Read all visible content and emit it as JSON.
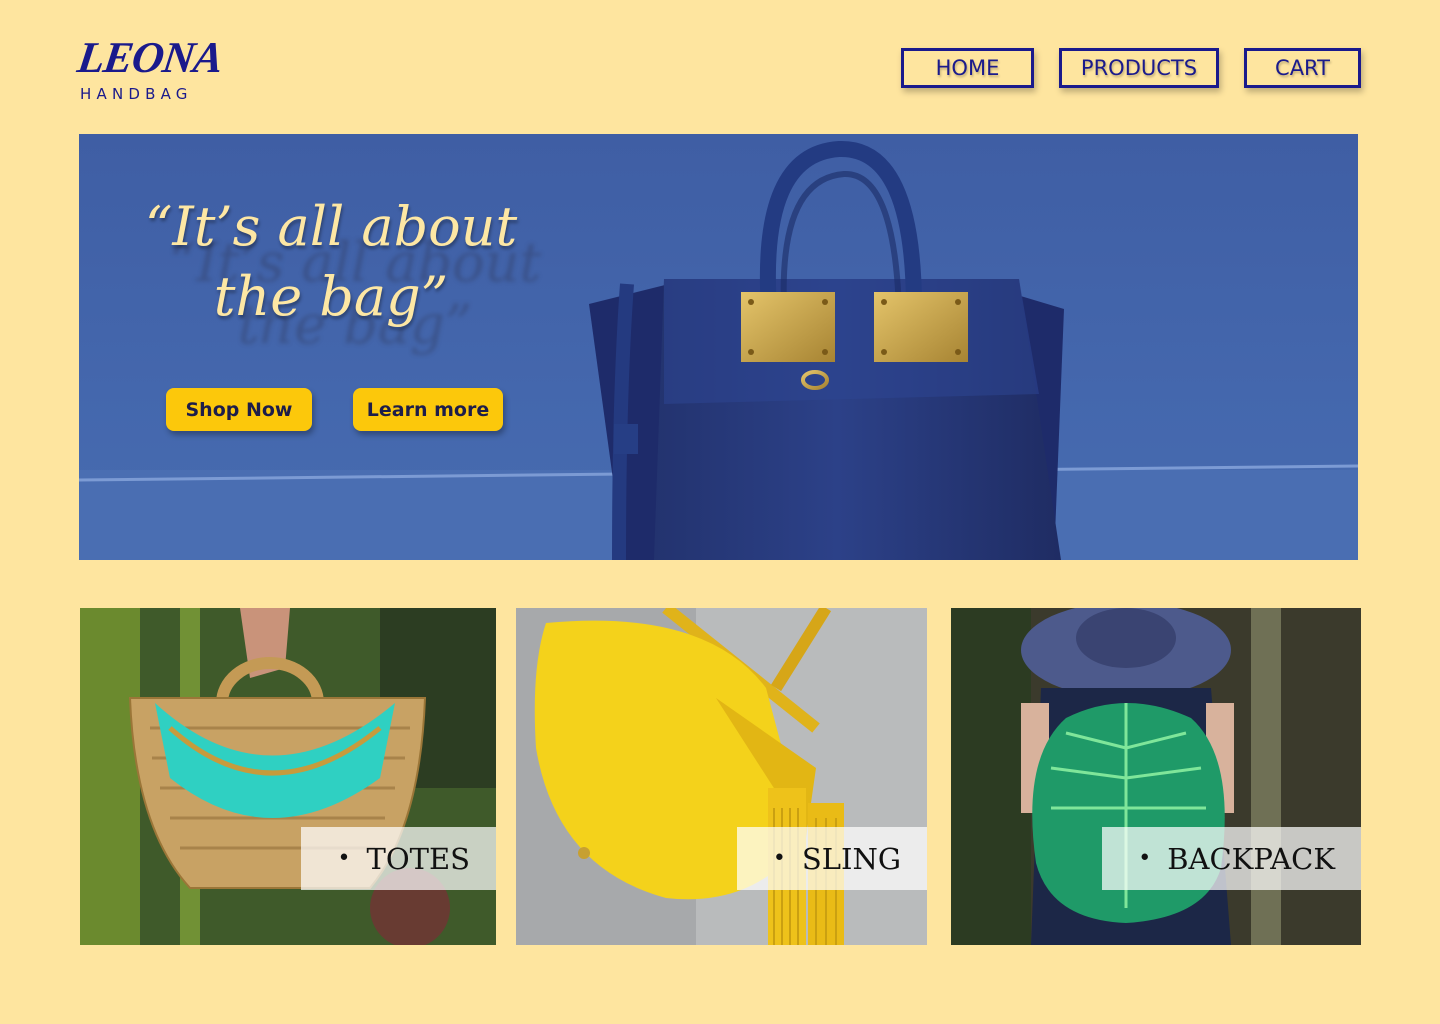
{
  "brand": {
    "name": "LEONA",
    "tagline": "HANDBAG",
    "color": "#1a1a8c"
  },
  "nav": {
    "items": [
      {
        "label": "HOME"
      },
      {
        "label": "PRODUCTS"
      },
      {
        "label": "CART"
      }
    ]
  },
  "hero": {
    "quote_line1": "“It’s all about",
    "quote_line2": "the bag”",
    "shop_label": "Shop Now",
    "learn_label": "Learn more",
    "accent": "#fcc80b",
    "background": "#4467ad"
  },
  "categories": [
    {
      "label": "TOTES",
      "bullet": "•"
    },
    {
      "label": "SLING",
      "bullet": "•"
    },
    {
      "label": "BACKPACK",
      "bullet": "•"
    }
  ],
  "page": {
    "background": "#fee59f"
  }
}
